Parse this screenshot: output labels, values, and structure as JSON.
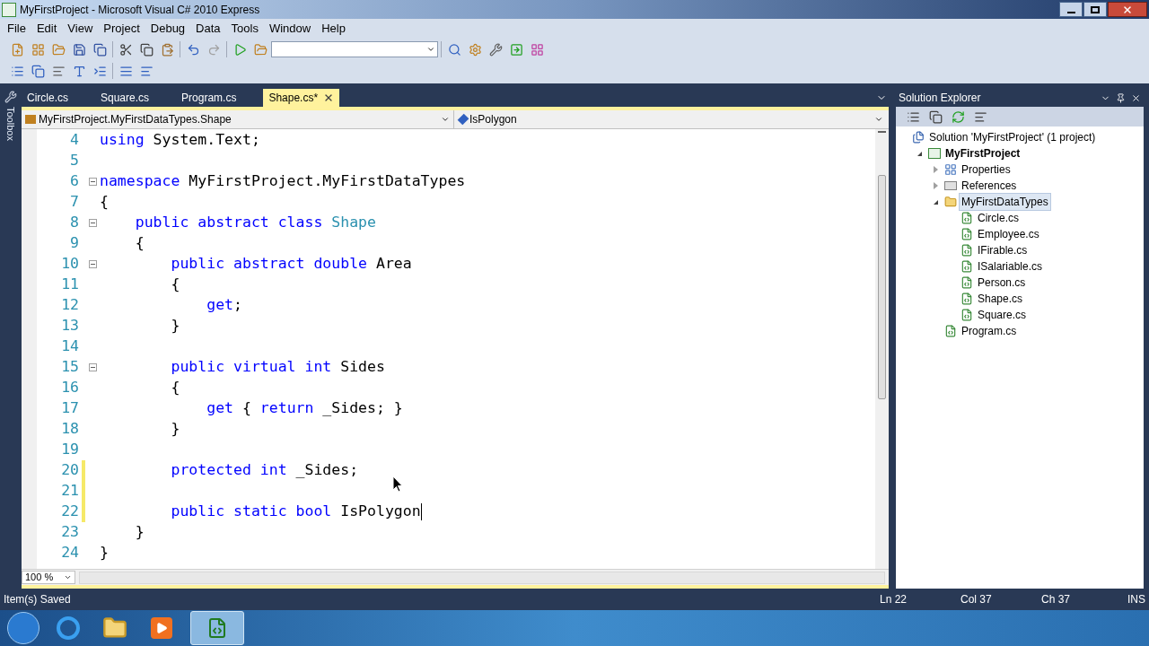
{
  "window": {
    "title": "MyFirstProject - Microsoft Visual C# 2010 Express"
  },
  "menu": [
    "File",
    "Edit",
    "View",
    "Project",
    "Debug",
    "Data",
    "Tools",
    "Window",
    "Help"
  ],
  "toolbox": {
    "label": "Toolbox"
  },
  "tabs": [
    {
      "label": "Circle.cs",
      "selected": false
    },
    {
      "label": "Square.cs",
      "selected": false
    },
    {
      "label": "Program.cs",
      "selected": false
    },
    {
      "label": "Shape.cs*",
      "selected": true
    }
  ],
  "navigation": {
    "type": "MyFirstProject.MyFirstDataTypes.Shape",
    "member": "IsPolygon"
  },
  "code_lines": [
    {
      "number": "4",
      "tokens": [
        {
          "kind": "keyword",
          "text": "using"
        },
        {
          "kind": "plain",
          "text": " System.Text;"
        }
      ]
    },
    {
      "number": "5"
    },
    {
      "number": "6",
      "fold": true,
      "tokens": [
        {
          "kind": "keyword",
          "text": "namespace"
        },
        {
          "kind": "plain",
          "text": " MyFirstProject.MyFirstDataTypes"
        }
      ]
    },
    {
      "number": "7",
      "tokens": [
        {
          "kind": "plain",
          "text": "{"
        }
      ]
    },
    {
      "number": "8",
      "fold": true,
      "tokens": [
        {
          "kind": "keyword",
          "text": "    public abstract class "
        },
        {
          "kind": "type",
          "text": "Shape"
        }
      ]
    },
    {
      "number": "9",
      "tokens": [
        {
          "kind": "plain",
          "text": "    {"
        }
      ]
    },
    {
      "number": "10",
      "fold": true,
      "tokens": [
        {
          "kind": "keyword",
          "text": "        public abstract double"
        },
        {
          "kind": "plain",
          "text": " Area"
        }
      ]
    },
    {
      "number": "11",
      "tokens": [
        {
          "kind": "plain",
          "text": "        {"
        }
      ]
    },
    {
      "number": "12",
      "tokens": [
        {
          "kind": "keyword",
          "text": "            get"
        },
        {
          "kind": "plain",
          "text": ";"
        }
      ]
    },
    {
      "number": "13",
      "tokens": [
        {
          "kind": "plain",
          "text": "        }"
        }
      ]
    },
    {
      "number": "14"
    },
    {
      "number": "15",
      "fold": true,
      "tokens": [
        {
          "kind": "keyword",
          "text": "        public virtual int"
        },
        {
          "kind": "plain",
          "text": " Sides"
        }
      ]
    },
    {
      "number": "16",
      "tokens": [
        {
          "kind": "plain",
          "text": "        {"
        }
      ]
    },
    {
      "number": "17",
      "tokens": [
        {
          "kind": "keyword",
          "text": "            get"
        },
        {
          "kind": "plain",
          "text": " { "
        },
        {
          "kind": "keyword",
          "text": "return"
        },
        {
          "kind": "plain",
          "text": " _Sides; }"
        }
      ]
    },
    {
      "number": "18",
      "tokens": [
        {
          "kind": "plain",
          "text": "        }"
        }
      ]
    },
    {
      "number": "19"
    },
    {
      "number": "20",
      "changed": true,
      "tokens": [
        {
          "kind": "keyword",
          "text": "        protected int"
        },
        {
          "kind": "plain",
          "text": " _Sides;"
        }
      ]
    },
    {
      "number": "21",
      "changed": true
    },
    {
      "number": "22",
      "changed": true,
      "caret": true,
      "tokens": [
        {
          "kind": "keyword",
          "text": "        public static bool"
        },
        {
          "kind": "plain",
          "text": " IsPolygon"
        }
      ]
    },
    {
      "number": "23",
      "tokens": [
        {
          "kind": "plain",
          "text": "    }"
        }
      ]
    },
    {
      "number": "24",
      "tokens": [
        {
          "kind": "plain",
          "text": "}"
        }
      ]
    }
  ],
  "zoom": "100 %",
  "solution_explorer": {
    "title": "Solution Explorer",
    "tree": [
      {
        "label": "Solution 'MyFirstProject' (1 project)",
        "kind": "solution",
        "bold": false,
        "selected": false,
        "children": [
          {
            "label": "MyFirstProject",
            "kind": "project",
            "bold": true,
            "selected": false,
            "expanded": true,
            "children": [
              {
                "label": "Properties",
                "kind": "properties",
                "bold": false,
                "selected": false,
                "expanded": false
              },
              {
                "label": "References",
                "kind": "references",
                "bold": false,
                "selected": false,
                "expanded": false
              },
              {
                "label": "MyFirstDataTypes",
                "kind": "folder",
                "bold": false,
                "selected": true,
                "expanded": true,
                "children": [
                  {
                    "label": "Circle.cs",
                    "kind": "file",
                    "bold": false,
                    "selected": false
                  },
                  {
                    "label": "Employee.cs",
                    "kind": "file",
                    "bold": false,
                    "selected": false
                  },
                  {
                    "label": "IFirable.cs",
                    "kind": "file",
                    "bold": false,
                    "selected": false
                  },
                  {
                    "label": "ISalariable.cs",
                    "kind": "file",
                    "bold": false,
                    "selected": false
                  },
                  {
                    "label": "Person.cs",
                    "kind": "file",
                    "bold": false,
                    "selected": false
                  },
                  {
                    "label": "Shape.cs",
                    "kind": "file",
                    "bold": false,
                    "selected": false
                  },
                  {
                    "label": "Square.cs",
                    "kind": "file",
                    "bold": false,
                    "selected": false
                  }
                ]
              },
              {
                "label": "Program.cs",
                "kind": "file",
                "bold": false,
                "selected": false
              }
            ]
          }
        ]
      }
    ]
  },
  "status_bar": {
    "message": "Item(s) Saved",
    "line": "Ln 22",
    "column": "Col 37",
    "char": "Ch 37",
    "mode": "INS"
  }
}
